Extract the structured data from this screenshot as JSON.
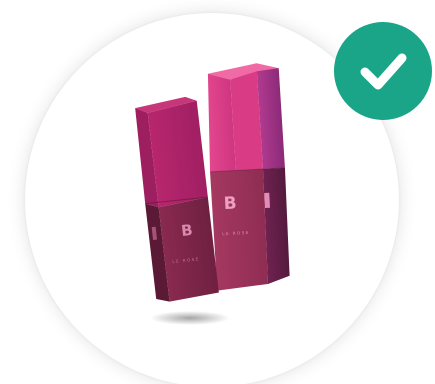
{
  "product": {
    "brand_letter": "B",
    "front_label": "LE ROSE",
    "back_label": "LE ROSE"
  },
  "status": {
    "icon": "checkmark-icon",
    "state": "selected",
    "color": "#1aa588"
  },
  "colors": {
    "bottle_light_top": "#d63c86",
    "bottle_light_side": "#9a2a6a",
    "bottle_dark_body": "#8b2a50",
    "bottle_dark_side": "#5c1c37"
  }
}
